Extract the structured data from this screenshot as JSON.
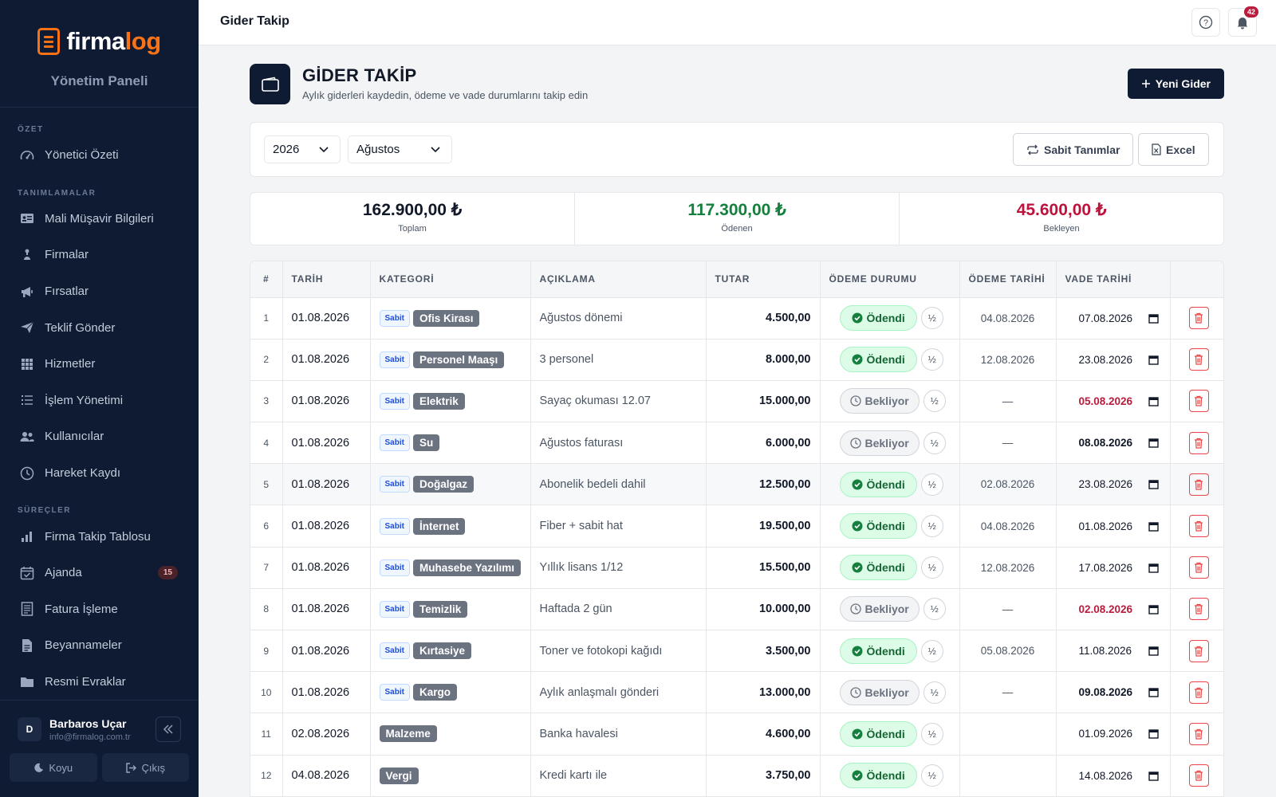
{
  "brand": {
    "name_a": "firma",
    "name_b": "log",
    "panel_title": "Yönetim Paneli"
  },
  "sidebar": {
    "sections": [
      {
        "title": "ÖZET",
        "items": [
          {
            "label": "Yönetici Özeti",
            "icon": "dashboard-gauge-icon"
          }
        ]
      },
      {
        "title": "TANIMLAMALAR",
        "items": [
          {
            "label": "Mali Müşavir Bilgileri",
            "icon": "id-card-icon"
          },
          {
            "label": "Firmalar",
            "icon": "sitemap-icon"
          },
          {
            "label": "Fırsatlar",
            "icon": "megaphone-icon"
          },
          {
            "label": "Teklif Gönder",
            "icon": "paper-plane-icon"
          },
          {
            "label": "Hizmetler",
            "icon": "grid-icon"
          },
          {
            "label": "İşlem Yönetimi",
            "icon": "list-icon"
          },
          {
            "label": "Kullanıcılar",
            "icon": "users-icon"
          },
          {
            "label": "Hareket Kaydı",
            "icon": "clock-icon"
          }
        ]
      },
      {
        "title": "SÜREÇLER",
        "items": [
          {
            "label": "Firma Takip Tablosu",
            "icon": "bar-chart-icon"
          },
          {
            "label": "Ajanda",
            "icon": "calendar-check-icon",
            "badge": "15"
          },
          {
            "label": "Fatura İşleme",
            "icon": "invoice-icon"
          },
          {
            "label": "Beyannameler",
            "icon": "document-icon"
          },
          {
            "label": "Resmi Evraklar",
            "icon": "folder-icon"
          }
        ]
      }
    ],
    "user": {
      "initial": "D",
      "name": "Barbaros Uçar",
      "email": "info@firmalog.com.tr"
    },
    "footer": {
      "theme_label": "Koyu",
      "logout_label": "Çıkış"
    }
  },
  "topbar": {
    "title": "Gider Takip",
    "notification_count": "42"
  },
  "page": {
    "title": "GİDER TAKİP",
    "subtitle": "Aylık giderleri kaydedin, ödeme ve vade durumlarını takip edin",
    "new_button": "Yeni Gider"
  },
  "filters": {
    "year": "2026",
    "month": "Ağustos",
    "fixed_button": "Sabit Tanımlar",
    "excel_button": "Excel"
  },
  "stats": [
    {
      "value": "162.900,00 ₺",
      "label": "Toplam",
      "color": "#111827"
    },
    {
      "value": "117.300,00 ₺",
      "label": "Ödenen",
      "color": "#15803d"
    },
    {
      "value": "45.600,00 ₺",
      "label": "Bekleyen",
      "color": "#be123c"
    }
  ],
  "table": {
    "columns": [
      "#",
      "TARİH",
      "KATEGORİ",
      "AÇIKLAMA",
      "TUTAR",
      "ÖDEME DURUMU",
      "ÖDEME TARİHİ",
      "VADE TARİHİ",
      ""
    ],
    "fixed_label": "Sabit",
    "half_label": "½",
    "status_labels": {
      "paid": "Ödendi",
      "waiting": "Bekliyor"
    },
    "rows": [
      {
        "no": "1",
        "date": "01.08.2026",
        "fixed": true,
        "category": "Ofis Kirası",
        "desc": "Ağustos dönemi",
        "amount": "4.500,00",
        "status": "paid",
        "pay_date": "04.08.2026",
        "due": "07.08.2026",
        "due_style": "plain"
      },
      {
        "no": "2",
        "date": "01.08.2026",
        "fixed": true,
        "category": "Personel Maaşı",
        "desc": "3 personel",
        "amount": "8.000,00",
        "status": "paid",
        "pay_date": "12.08.2026",
        "due": "23.08.2026",
        "due_style": "plain"
      },
      {
        "no": "3",
        "date": "01.08.2026",
        "fixed": true,
        "category": "Elektrik",
        "desc": "Sayaç okuması 12.07",
        "amount": "15.000,00",
        "status": "waiting",
        "pay_date": "—",
        "due": "05.08.2026",
        "due_style": "red"
      },
      {
        "no": "4",
        "date": "01.08.2026",
        "fixed": true,
        "category": "Su",
        "desc": "Ağustos faturası",
        "amount": "6.000,00",
        "status": "waiting",
        "pay_date": "—",
        "due": "08.08.2026",
        "due_style": "bold"
      },
      {
        "no": "5",
        "date": "01.08.2026",
        "fixed": true,
        "category": "Doğalgaz",
        "desc": "Abonelik bedeli dahil",
        "amount": "12.500,00",
        "status": "paid",
        "pay_date": "02.08.2026",
        "due": "23.08.2026",
        "due_style": "plain",
        "highlight": true
      },
      {
        "no": "6",
        "date": "01.08.2026",
        "fixed": true,
        "category": "İnternet",
        "desc": "Fiber + sabit hat",
        "amount": "19.500,00",
        "status": "paid",
        "pay_date": "04.08.2026",
        "due": "01.08.2026",
        "due_style": "plain"
      },
      {
        "no": "7",
        "date": "01.08.2026",
        "fixed": true,
        "category": "Muhasebe Yazılımı",
        "desc": "Yıllık lisans 1/12",
        "amount": "15.500,00",
        "status": "paid",
        "pay_date": "12.08.2026",
        "due": "17.08.2026",
        "due_style": "plain"
      },
      {
        "no": "8",
        "date": "01.08.2026",
        "fixed": true,
        "category": "Temizlik",
        "desc": "Haftada 2 gün",
        "amount": "10.000,00",
        "status": "waiting",
        "pay_date": "—",
        "due": "02.08.2026",
        "due_style": "red"
      },
      {
        "no": "9",
        "date": "01.08.2026",
        "fixed": true,
        "category": "Kırtasiye",
        "desc": "Toner ve fotokopi kağıdı",
        "amount": "3.500,00",
        "status": "paid",
        "pay_date": "05.08.2026",
        "due": "11.08.2026",
        "due_style": "plain"
      },
      {
        "no": "10",
        "date": "01.08.2026",
        "fixed": true,
        "category": "Kargo",
        "desc": "Aylık anlaşmalı gönderi",
        "amount": "13.000,00",
        "status": "waiting",
        "pay_date": "—",
        "due": "09.08.2026",
        "due_style": "bold"
      },
      {
        "no": "11",
        "date": "02.08.2026",
        "fixed": false,
        "category": "Malzeme",
        "desc": "Banka havalesi",
        "amount": "4.600,00",
        "status": "paid",
        "pay_date": "",
        "due": "01.09.2026",
        "due_style": "plain"
      },
      {
        "no": "12",
        "date": "04.08.2026",
        "fixed": false,
        "category": "Vergi",
        "desc": "Kredi kartı ile",
        "amount": "3.750,00",
        "status": "paid",
        "pay_date": "",
        "due": "14.08.2026",
        "due_style": "plain"
      }
    ]
  }
}
